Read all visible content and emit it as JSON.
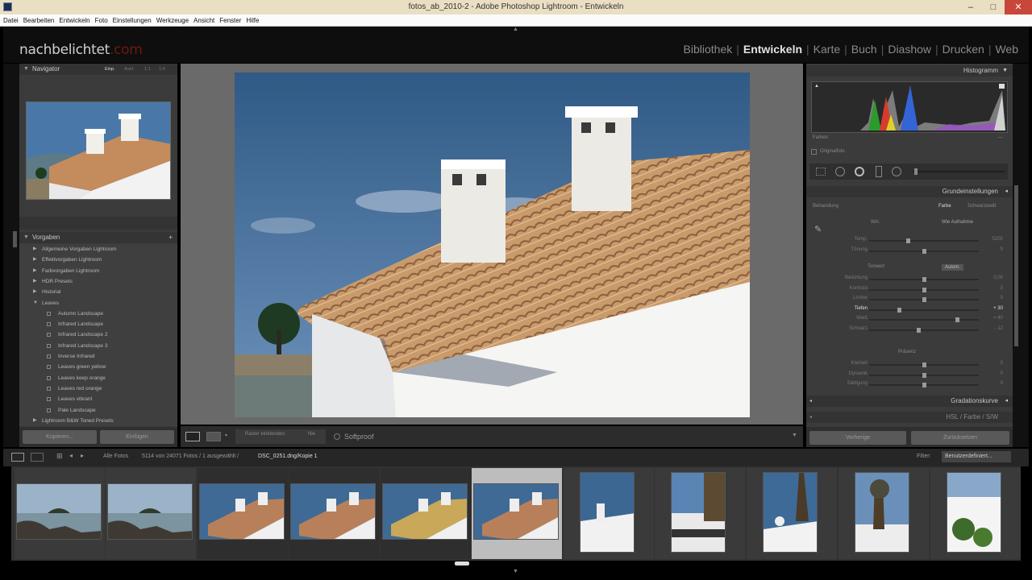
{
  "window": {
    "title": "fotos_ab_2010-2 - Adobe Photoshop Lightroom - Entwickeln",
    "controls": {
      "minimize": "–",
      "maximize": "□",
      "close": "✕"
    }
  },
  "menu": [
    "Datei",
    "Bearbeiten",
    "Entwickeln",
    "Foto",
    "Einstellungen",
    "Werkzeuge",
    "Ansicht",
    "Fenster",
    "Hilfe"
  ],
  "identity": {
    "name": "nachbelichtet",
    "suffix": ".com"
  },
  "modules": [
    {
      "label": "Bibliothek",
      "active": false
    },
    {
      "label": "Entwickeln",
      "active": true
    },
    {
      "label": "Karte",
      "active": false
    },
    {
      "label": "Buch",
      "active": false
    },
    {
      "label": "Diashow",
      "active": false
    },
    {
      "label": "Drucken",
      "active": false
    },
    {
      "label": "Web",
      "active": false
    }
  ],
  "navigator": {
    "title": "Navigator",
    "zoom_options": [
      "Einp.",
      "Ausf.",
      "1:1",
      "1:4"
    ]
  },
  "presets": {
    "title": "Vorgaben",
    "add": "+",
    "items": [
      {
        "label": "Allgemeine Vorgaben Lightroom",
        "level": 0
      },
      {
        "label": "Effektvorgaben Lightroom",
        "level": 0
      },
      {
        "label": "Farbvorgaben Lightroom",
        "level": 0
      },
      {
        "label": "HDR Presets",
        "level": 0
      },
      {
        "label": "Historial",
        "level": 0
      },
      {
        "label": "Leaves",
        "level": 0,
        "open": true
      },
      {
        "label": "Autumn Landscape",
        "level": 1
      },
      {
        "label": "Infrared Landscape",
        "level": 1
      },
      {
        "label": "Infrared Landscape 2",
        "level": 1
      },
      {
        "label": "Infrared Landscape 3",
        "level": 1
      },
      {
        "label": "Inverse Infrared",
        "level": 1
      },
      {
        "label": "Leaves green yellow",
        "level": 1
      },
      {
        "label": "Leaves keep orange",
        "level": 1
      },
      {
        "label": "Leaves red orange",
        "level": 1
      },
      {
        "label": "Leaves vibrant",
        "level": 1
      },
      {
        "label": "Pale Landscape",
        "level": 1
      },
      {
        "label": "Lightroom B&W Toned Presets",
        "level": 0
      }
    ]
  },
  "left_buttons": {
    "copy": "Kopieren...",
    "paste": "Einfügen"
  },
  "toolbar": {
    "view_label": "Raster einblenden:",
    "view_value": "Nie",
    "softproof": "Softproof"
  },
  "right": {
    "histogram_title": "Histogramm",
    "histo_bottom_left": "Farben",
    "histo_bottom_right": "—",
    "original_photo": "Originalfoto",
    "basic_title": "Grundeinstellungen",
    "treatment_label": "Behandlung",
    "treatment_color": "Farbe",
    "treatment_bw": "Schwarzweiß",
    "wb_label": "WA:",
    "wb_value": "Wie Aufnahme",
    "sliders_wb": [
      {
        "label": "Temp.",
        "value": "5200",
        "pos": 0.35
      },
      {
        "label": "Tönung",
        "value": "0",
        "pos": 0.5
      }
    ],
    "tone_label": "Tonwert",
    "auto_label": "Autom.",
    "sliders_tone": [
      {
        "label": "Belichtung",
        "value": "0,00",
        "pos": 0.5
      },
      {
        "label": "Kontrast",
        "value": "0",
        "pos": 0.5
      },
      {
        "label": "Lichter",
        "value": "0",
        "pos": 0.5
      },
      {
        "label": "Tiefen",
        "value": "+ 30",
        "pos": 0.27,
        "hl": true
      },
      {
        "label": "Weiß",
        "value": "+ 40",
        "pos": 0.82
      },
      {
        "label": "Schwarz",
        "value": "- 12",
        "pos": 0.45
      }
    ],
    "presence_label": "Präsenz",
    "sliders_presence": [
      {
        "label": "Klarheit",
        "value": "0",
        "pos": 0.5
      },
      {
        "label": "Dynamik",
        "value": "0",
        "pos": 0.5
      },
      {
        "label": "Sättigung",
        "value": "0",
        "pos": 0.5
      }
    ],
    "gradation_title": "Gradationskurve",
    "hsl_title": [
      "HSL",
      "/",
      "Farbe",
      "/",
      "S/W"
    ],
    "prev_button": "Vorherige",
    "reset_button": "Zurücksetzen"
  },
  "filmbar": {
    "source": "Alle Fotos",
    "count": "5114 von 24071 Fotos / 1 ausgewählt /",
    "file": "DSC_0251.dng/Kopie 1",
    "filter_label": "Filter:",
    "filter_value": "Benutzerdefiniert..."
  },
  "thumb_colors": {
    "sky": "#3f6a96",
    "roof": "#b8805a",
    "sea": "#7c93a0"
  }
}
